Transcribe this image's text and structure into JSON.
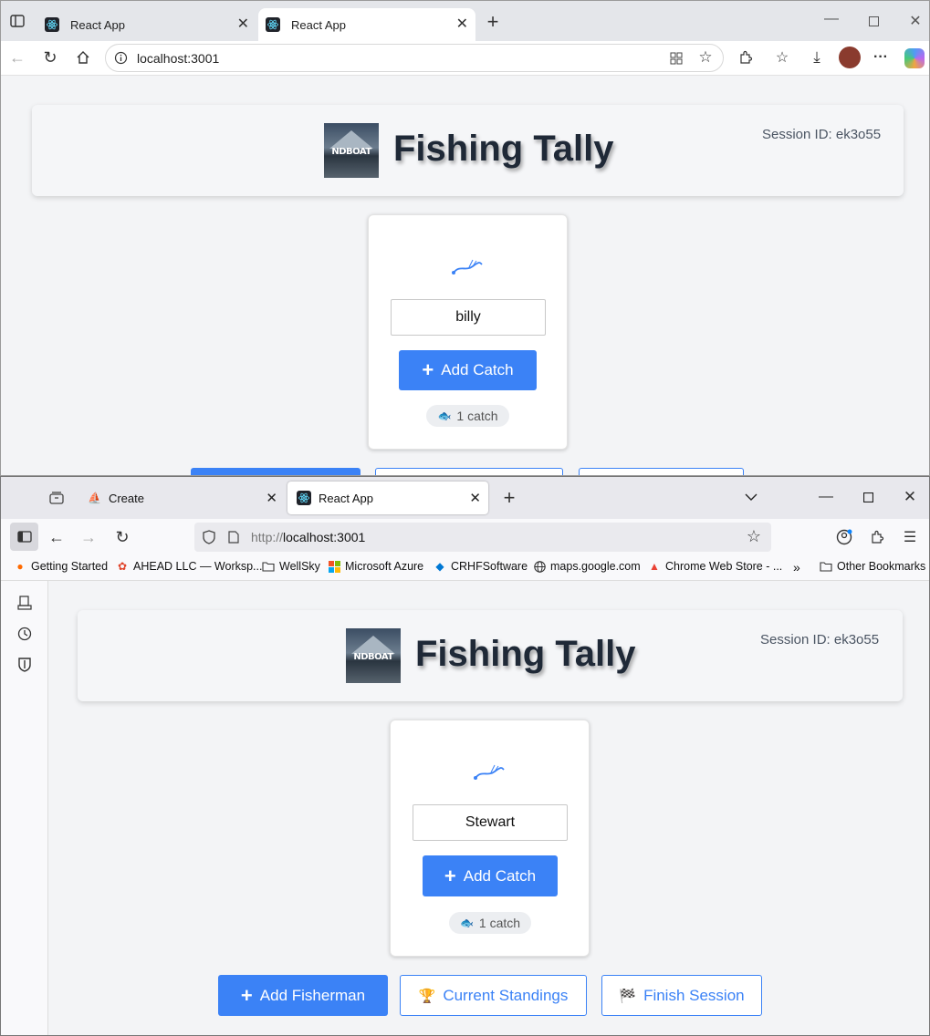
{
  "edge": {
    "tabs": [
      {
        "label": "React App"
      },
      {
        "label": "React App"
      }
    ],
    "address": "localhost:3001"
  },
  "firefox": {
    "tabs": [
      {
        "label": "Create"
      },
      {
        "label": "React App"
      }
    ],
    "address_prefix": "http://",
    "address_host": "localhost:3001",
    "bookmarks": [
      {
        "label": "Getting Started",
        "icon": "firefox-icon"
      },
      {
        "label": "AHEAD LLC — Worksp...",
        "icon": "ahead-icon"
      },
      {
        "label": "WellSky",
        "icon": "folder-icon"
      },
      {
        "label": "Microsoft Azure",
        "icon": "microsoft-icon"
      },
      {
        "label": "CRHFSoftware",
        "icon": "azure-devops-icon"
      },
      {
        "label": "maps.google.com",
        "icon": "globe-icon"
      },
      {
        "label": "Chrome Web Store - ...",
        "icon": "chrome-web-store-icon"
      },
      {
        "label": "Other Bookmarks",
        "icon": "folder-icon"
      }
    ]
  },
  "app": {
    "title": "Fishing Tally",
    "logo_text": "NDBOAT",
    "session_label": "Session ID: ek3o55",
    "add_catch_label": "Add Catch",
    "add_fisherman_label": "Add Fisherman",
    "standings_label": "Current Standings",
    "finish_label": "Finish Session"
  },
  "edge_fisherman": {
    "name": "billy",
    "catch_count": "1 catch"
  },
  "ff_fisherman": {
    "name": "Stewart",
    "catch_count": "1 catch"
  },
  "colors": {
    "accent": "#3b82f6",
    "title": "#1f2937"
  }
}
